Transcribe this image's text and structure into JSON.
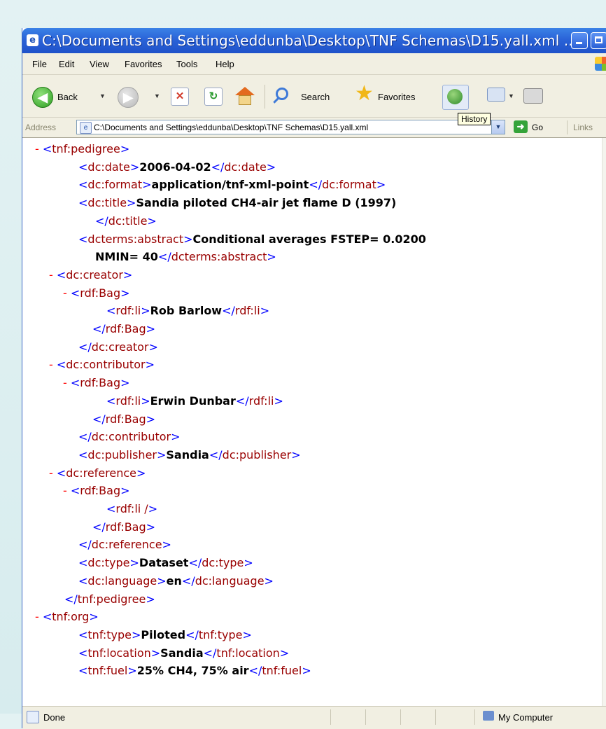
{
  "window": {
    "title": "C:\\Documents and Settings\\eddunba\\Desktop\\TNF Schemas\\D15.yall.xml ..."
  },
  "menu": [
    "File",
    "Edit",
    "View",
    "Favorites",
    "Tools",
    "Help"
  ],
  "toolbar": {
    "back_label": "Back",
    "search_label": "Search",
    "favorites_label": "Favorites",
    "history_tooltip": "History"
  },
  "address": {
    "label": "Address",
    "value": "C:\\Documents and Settings\\eddunba\\Desktop\\TNF Schemas\\D15.yall.xml",
    "go_label": "Go",
    "links_label": "Links"
  },
  "status": {
    "text": "Done",
    "zone": "My Computer"
  },
  "colors": {
    "tag": "#990000",
    "bracket": "#0000ff",
    "collapse": "#ff0000",
    "value": "#000000"
  },
  "xml_lines": [
    {
      "indent": 0,
      "collapse": "-",
      "open": "tnf:pedigree",
      "text": "",
      "close": ""
    },
    {
      "indent": 1,
      "collapse": "",
      "open": "dc:date",
      "text": "2006-04-02",
      "close": "dc:date"
    },
    {
      "indent": 1,
      "collapse": "",
      "open": "dc:format",
      "text": "application/tnf-xml-point",
      "close": "dc:format"
    },
    {
      "indent": 1,
      "collapse": "",
      "open": "dc:title",
      "text": "Sandia piloted CH4-air jet flame D (1997)",
      "close": ""
    },
    {
      "indent": 1.6,
      "collapse": "",
      "open": "",
      "text": "",
      "close": "dc:title"
    },
    {
      "indent": 1,
      "collapse": "",
      "open": "dcterms:abstract",
      "text": "Conditional averages FSTEP= 0.0200",
      "close": ""
    },
    {
      "indent": 1.6,
      "collapse": "",
      "open": "",
      "text": "NMIN= 40",
      "close": "dcterms:abstract"
    },
    {
      "indent": 0.5,
      "collapse": "-",
      "open": "dc:creator",
      "text": "",
      "close": ""
    },
    {
      "indent": 1,
      "collapse": "-",
      "open": "rdf:Bag",
      "text": "",
      "close": ""
    },
    {
      "indent": 2,
      "collapse": "",
      "open": "rdf:li",
      "text": "Rob Barlow",
      "close": "rdf:li"
    },
    {
      "indent": 1.5,
      "collapse": "",
      "open": "",
      "text": "",
      "close": "rdf:Bag"
    },
    {
      "indent": 1,
      "collapse": "",
      "open": "",
      "text": "",
      "close": "dc:creator"
    },
    {
      "indent": 0.5,
      "collapse": "-",
      "open": "dc:contributor",
      "text": "",
      "close": ""
    },
    {
      "indent": 1,
      "collapse": "-",
      "open": "rdf:Bag",
      "text": "",
      "close": ""
    },
    {
      "indent": 2,
      "collapse": "",
      "open": "rdf:li",
      "text": "Erwin Dunbar",
      "close": "rdf:li"
    },
    {
      "indent": 1.5,
      "collapse": "",
      "open": "",
      "text": "",
      "close": "rdf:Bag"
    },
    {
      "indent": 1,
      "collapse": "",
      "open": "",
      "text": "",
      "close": "dc:contributor"
    },
    {
      "indent": 1,
      "collapse": "",
      "open": "dc:publisher",
      "text": "Sandia",
      "close": "dc:publisher"
    },
    {
      "indent": 0.5,
      "collapse": "-",
      "open": "dc:reference",
      "text": "",
      "close": ""
    },
    {
      "indent": 1,
      "collapse": "-",
      "open": "rdf:Bag",
      "text": "",
      "close": ""
    },
    {
      "indent": 2,
      "collapse": "",
      "open": "rdf:li /",
      "text": "",
      "close": ""
    },
    {
      "indent": 1.5,
      "collapse": "",
      "open": "",
      "text": "",
      "close": "rdf:Bag"
    },
    {
      "indent": 1,
      "collapse": "",
      "open": "",
      "text": "",
      "close": "dc:reference"
    },
    {
      "indent": 1,
      "collapse": "",
      "open": "dc:type",
      "text": "Dataset",
      "close": "dc:type"
    },
    {
      "indent": 1,
      "collapse": "",
      "open": "dc:language",
      "text": "en",
      "close": "dc:language"
    },
    {
      "indent": 0.5,
      "collapse": "",
      "open": "",
      "text": "",
      "close": "tnf:pedigree"
    },
    {
      "indent": 0,
      "collapse": "-",
      "open": "tnf:org",
      "text": "",
      "close": ""
    },
    {
      "indent": 1,
      "collapse": "",
      "open": "tnf:type",
      "text": "Piloted",
      "close": "tnf:type"
    },
    {
      "indent": 1,
      "collapse": "",
      "open": "tnf:location",
      "text": "Sandia",
      "close": "tnf:location"
    },
    {
      "indent": 1,
      "collapse": "",
      "open": "tnf:fuel",
      "text": "25% CH4, 75% air",
      "close": "tnf:fuel"
    }
  ]
}
